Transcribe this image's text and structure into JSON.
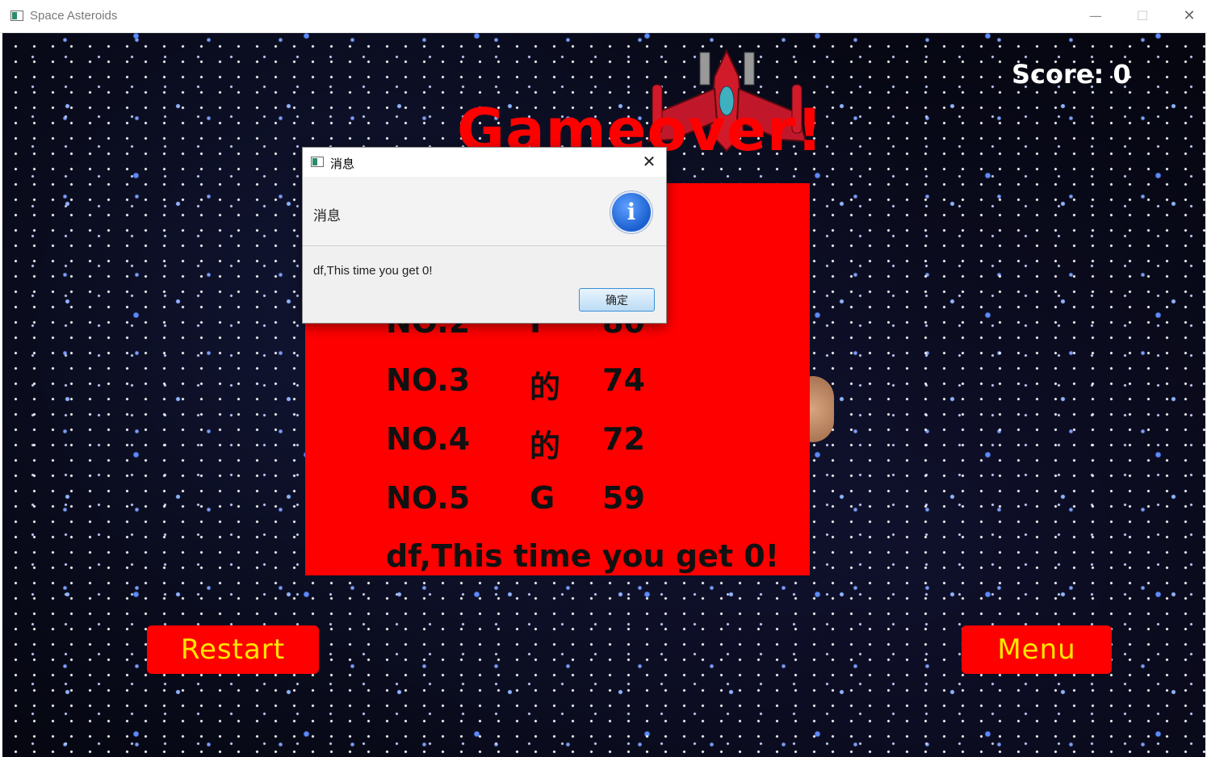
{
  "window": {
    "title": "Space Asteroids",
    "controls": {
      "minimize": "—",
      "maximize": "☐",
      "close": "✕"
    }
  },
  "game": {
    "score_text": "Score: 0",
    "gameover_text": "Gameover!",
    "leaderboard": [
      {
        "rank": "NO.2",
        "name": "F",
        "score": "80"
      },
      {
        "rank": "NO.3",
        "name": "的",
        "score": "74"
      },
      {
        "rank": "NO.4",
        "name": "的",
        "score": "72"
      },
      {
        "rank": "NO.5",
        "name": "G",
        "score": "59"
      }
    ],
    "result_message": "df,This time you get 0!",
    "restart_label": "Restart",
    "menu_label": "Menu"
  },
  "dialog": {
    "title": "消息",
    "header_text": "消息",
    "icon": "info-icon",
    "icon_glyph": "i",
    "body_text": "df,This time you get 0!",
    "ok_label": "确定",
    "close_glyph": "✕"
  },
  "colors": {
    "board": "#ff0000",
    "button_text": "#ffe600",
    "gameover": "#ff0000"
  }
}
